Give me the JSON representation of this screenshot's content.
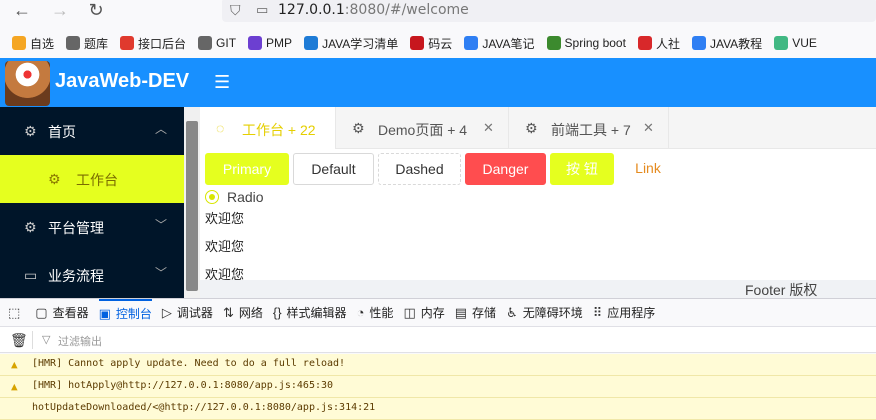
{
  "browser": {
    "url_host": "127.0.0.1",
    "url_rest": ":8080/#/welcome",
    "bookmarks": [
      {
        "label": "自选",
        "color": "#f5a623"
      },
      {
        "label": "题库",
        "color": "#666666"
      },
      {
        "label": "接口后台",
        "color": "#e03a2e"
      },
      {
        "label": "GIT",
        "color": "#666666"
      },
      {
        "label": "PMP",
        "color": "#6c3fd1"
      },
      {
        "label": "JAVA学习清单",
        "color": "#1e7bd6"
      },
      {
        "label": "码云",
        "color": "#c7171e"
      },
      {
        "label": "JAVA笔记",
        "color": "#2f7ff3"
      },
      {
        "label": "Spring boot",
        "color": "#3c8a2e"
      },
      {
        "label": "人社",
        "color": "#d8282a"
      },
      {
        "label": "JAVA教程",
        "color": "#2f7ff3"
      },
      {
        "label": "VUE",
        "color": "#41b883"
      }
    ]
  },
  "app": {
    "title": "JavaWeb-DEV",
    "colors": {
      "header": "#1890ff",
      "sidebar": "#001529",
      "accent": "#e5ff1f"
    },
    "menu": {
      "home": "首页",
      "workbench": "工作台",
      "platform": "平台管理",
      "process": "业务流程"
    },
    "tabs": [
      {
        "label": "工作台 + 22"
      },
      {
        "label": "Demo页面 + 4"
      },
      {
        "label": "前端工具 + 7"
      }
    ],
    "buttons": {
      "primary": "Primary",
      "default": "Default",
      "dashed": "Dashed",
      "danger": "Danger",
      "cn": "按 钮",
      "link": "Link"
    },
    "radio_label": "Radio",
    "welcome": [
      "欢迎您",
      "欢迎您",
      "欢迎您"
    ],
    "footer": "Footer 版权"
  },
  "devtools": {
    "tabs": [
      "查看器",
      "控制台",
      "调试器",
      "网络",
      "样式编辑器",
      "性能",
      "内存",
      "存储",
      "无障碍环境",
      "应用程序"
    ],
    "active_tab": "控制台",
    "filter_placeholder": "过滤输出",
    "logs": [
      "[HMR] Cannot apply update. Need to do a full reload!",
      "[HMR] hotApply@http://127.0.0.1:8080/app.js:465:30",
      "hotUpdateDownloaded/<@http://127.0.0.1:8080/app.js:314:21"
    ]
  }
}
